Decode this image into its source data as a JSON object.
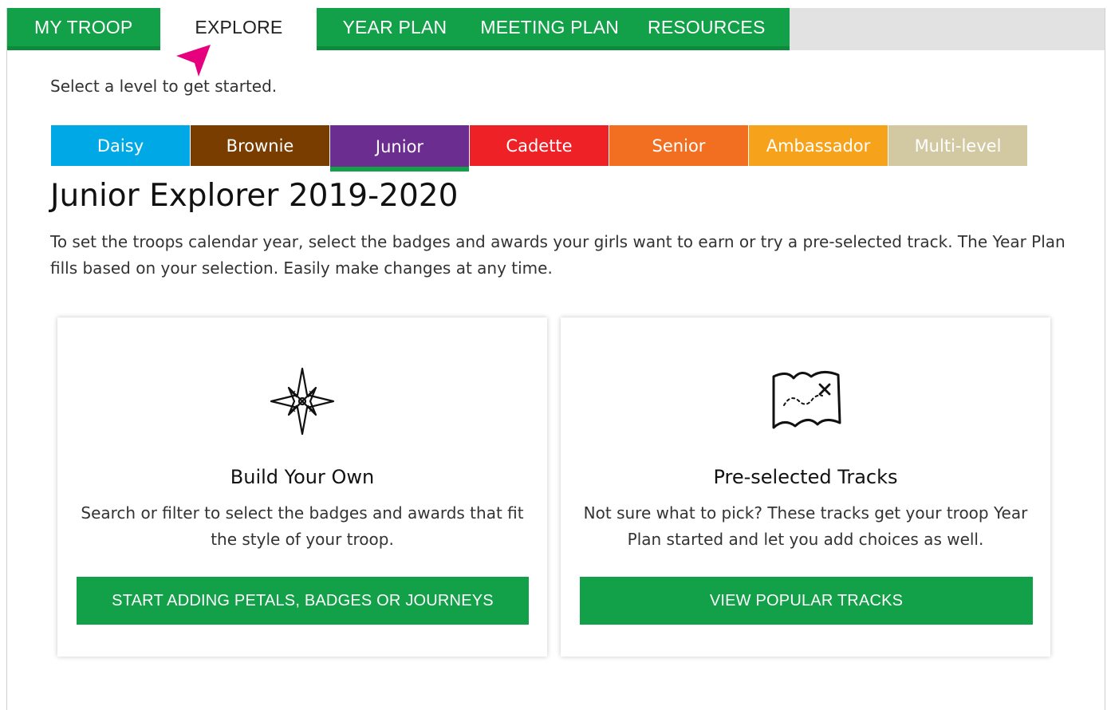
{
  "nav": {
    "tabs": [
      {
        "label": "MY TROOP"
      },
      {
        "label": "EXPLORE"
      },
      {
        "label": "YEAR PLAN"
      },
      {
        "label": "MEETING PLAN"
      },
      {
        "label": "RESOURCES"
      }
    ],
    "active_index": 1
  },
  "intro_text": "Select a level to get started.",
  "levels": [
    {
      "label": "Daisy",
      "color": "#00a9e6"
    },
    {
      "label": "Brownie",
      "color": "#7a3d00"
    },
    {
      "label": "Junior",
      "color": "#6b2d90"
    },
    {
      "label": "Cadette",
      "color": "#ee2127"
    },
    {
      "label": "Senior",
      "color": "#f26f21"
    },
    {
      "label": "Ambassador",
      "color": "#f7a21b"
    },
    {
      "label": "Multi-level",
      "color": "#d2c8a2"
    }
  ],
  "selected_level": "Junior",
  "page_title": "Junior Explorer 2019-2020",
  "description": "To set the troops calendar year, select the badges and awards your girls want to earn or try a pre-selected track. The Year Plan fills based on your selection. Easily make changes at any time.",
  "cards": [
    {
      "icon": "compass-star-icon",
      "title": "Build Your Own",
      "text": "Search or filter to select the badges and awards that fit the style of your troop.",
      "button": "START ADDING PETALS, BADGES OR JOURNEYS"
    },
    {
      "icon": "treasure-map-icon",
      "title": "Pre-selected Tracks",
      "text": "Not sure what to pick? These tracks get your troop Year Plan started and let you add choices as well.",
      "button": "VIEW POPULAR TRACKS"
    }
  ],
  "colors": {
    "brand_green": "#12a048",
    "pointer": "#e6007e"
  }
}
